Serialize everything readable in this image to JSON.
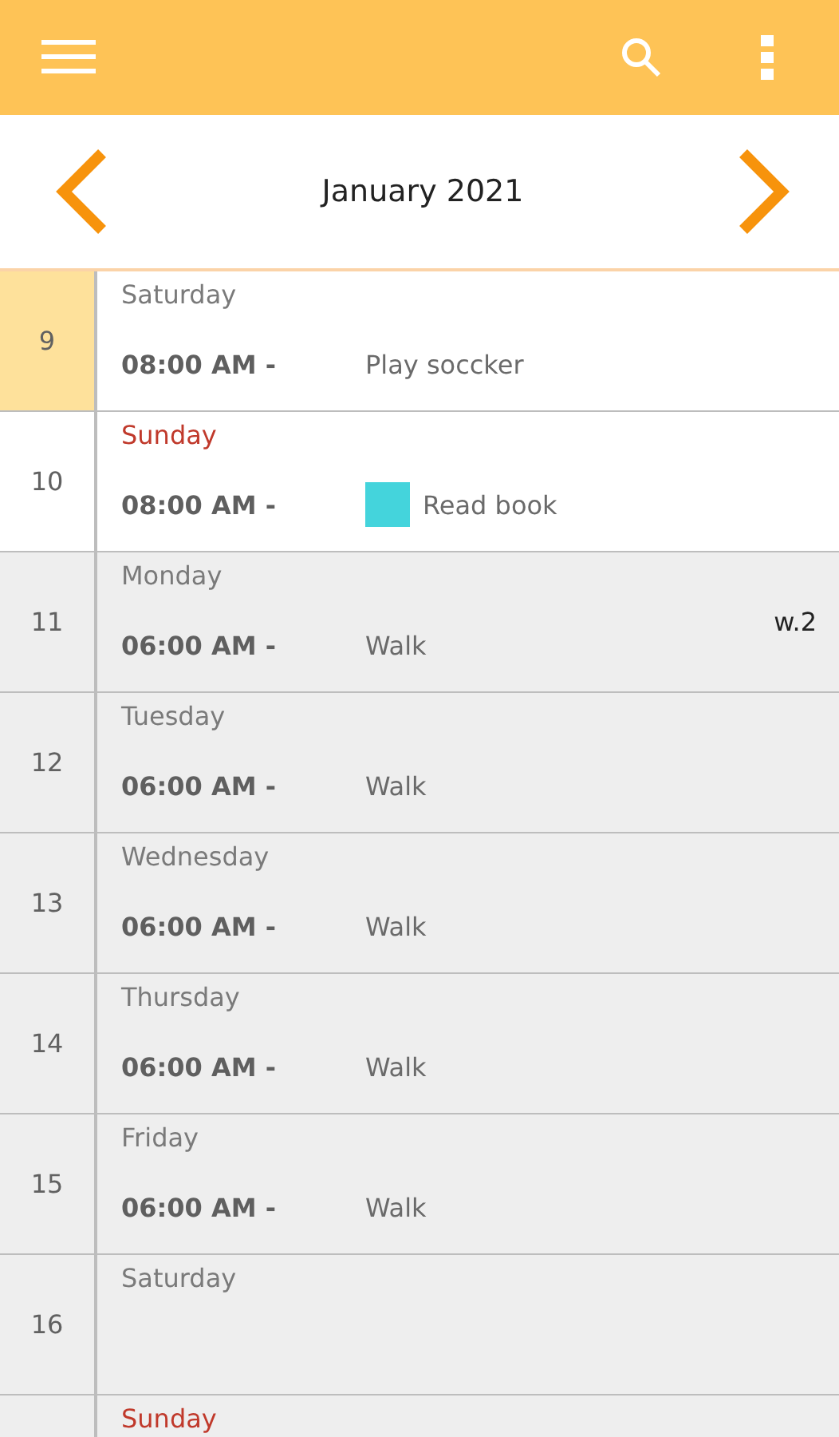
{
  "month_nav": {
    "title": "January 2021"
  },
  "days": [
    {
      "date": "9",
      "day": "Saturday",
      "today": true,
      "shaded": false,
      "red": false,
      "events": [
        {
          "time": "08:00 AM -",
          "title": "Play soccker"
        }
      ]
    },
    {
      "date": "10",
      "day": "Sunday",
      "today": false,
      "shaded": false,
      "red": true,
      "events": [
        {
          "time": "08:00 AM -",
          "title": "Read book",
          "color": "#44d4dc"
        }
      ]
    },
    {
      "date": "11",
      "day": "Monday",
      "today": false,
      "shaded": true,
      "red": false,
      "week": "w.2",
      "events": [
        {
          "time": "06:00 AM -",
          "title": "Walk"
        }
      ]
    },
    {
      "date": "12",
      "day": "Tuesday",
      "today": false,
      "shaded": true,
      "red": false,
      "events": [
        {
          "time": "06:00 AM -",
          "title": "Walk"
        }
      ]
    },
    {
      "date": "13",
      "day": "Wednesday",
      "today": false,
      "shaded": true,
      "red": false,
      "events": [
        {
          "time": "06:00 AM -",
          "title": "Walk"
        }
      ]
    },
    {
      "date": "14",
      "day": "Thursday",
      "today": false,
      "shaded": true,
      "red": false,
      "events": [
        {
          "time": "06:00 AM -",
          "title": "Walk"
        }
      ]
    },
    {
      "date": "15",
      "day": "Friday",
      "today": false,
      "shaded": true,
      "red": false,
      "events": [
        {
          "time": "06:00 AM -",
          "title": "Walk"
        }
      ]
    },
    {
      "date": "16",
      "day": "Saturday",
      "today": false,
      "shaded": true,
      "red": false
    },
    {
      "day": "Sunday",
      "today": false,
      "shaded": true,
      "red": true
    }
  ]
}
